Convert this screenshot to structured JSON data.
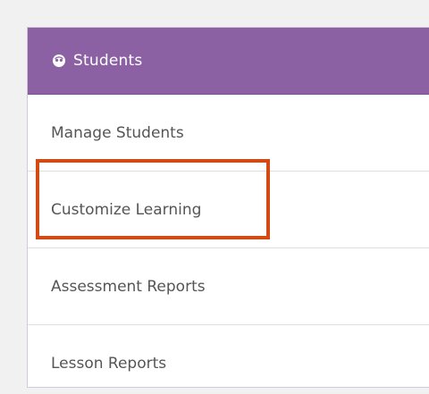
{
  "panel": {
    "header": {
      "icon": "student-face-icon",
      "title": "Students"
    },
    "items": [
      {
        "label": "Manage Students"
      },
      {
        "label": "Customize Learning"
      },
      {
        "label": "Assessment Reports"
      },
      {
        "label": "Lesson Reports"
      }
    ]
  },
  "colors": {
    "header_bg": "#8c61a4",
    "highlight_border": "#d24a14",
    "item_text": "#555555"
  }
}
